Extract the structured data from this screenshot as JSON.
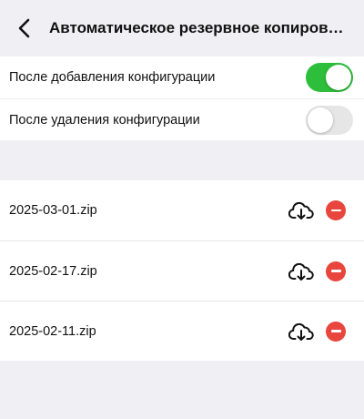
{
  "header": {
    "title": "Автоматическое резервное копиров…"
  },
  "settings": [
    {
      "label": "После добавления конфигурации",
      "enabled": true
    },
    {
      "label": "После удаления конфигурации",
      "enabled": false
    }
  ],
  "files": [
    {
      "name": "2025-03-01.zip"
    },
    {
      "name": "2025-02-17.zip"
    },
    {
      "name": "2025-02-11.zip"
    }
  ],
  "colors": {
    "toggle_on": "#2dbe3c",
    "toggle_off": "#e6e6e6",
    "delete": "#e8453c",
    "background": "#efeff4"
  },
  "icons": {
    "back": "chevron-left-icon",
    "download": "cloud-download-icon",
    "delete": "minus-circle-icon"
  }
}
